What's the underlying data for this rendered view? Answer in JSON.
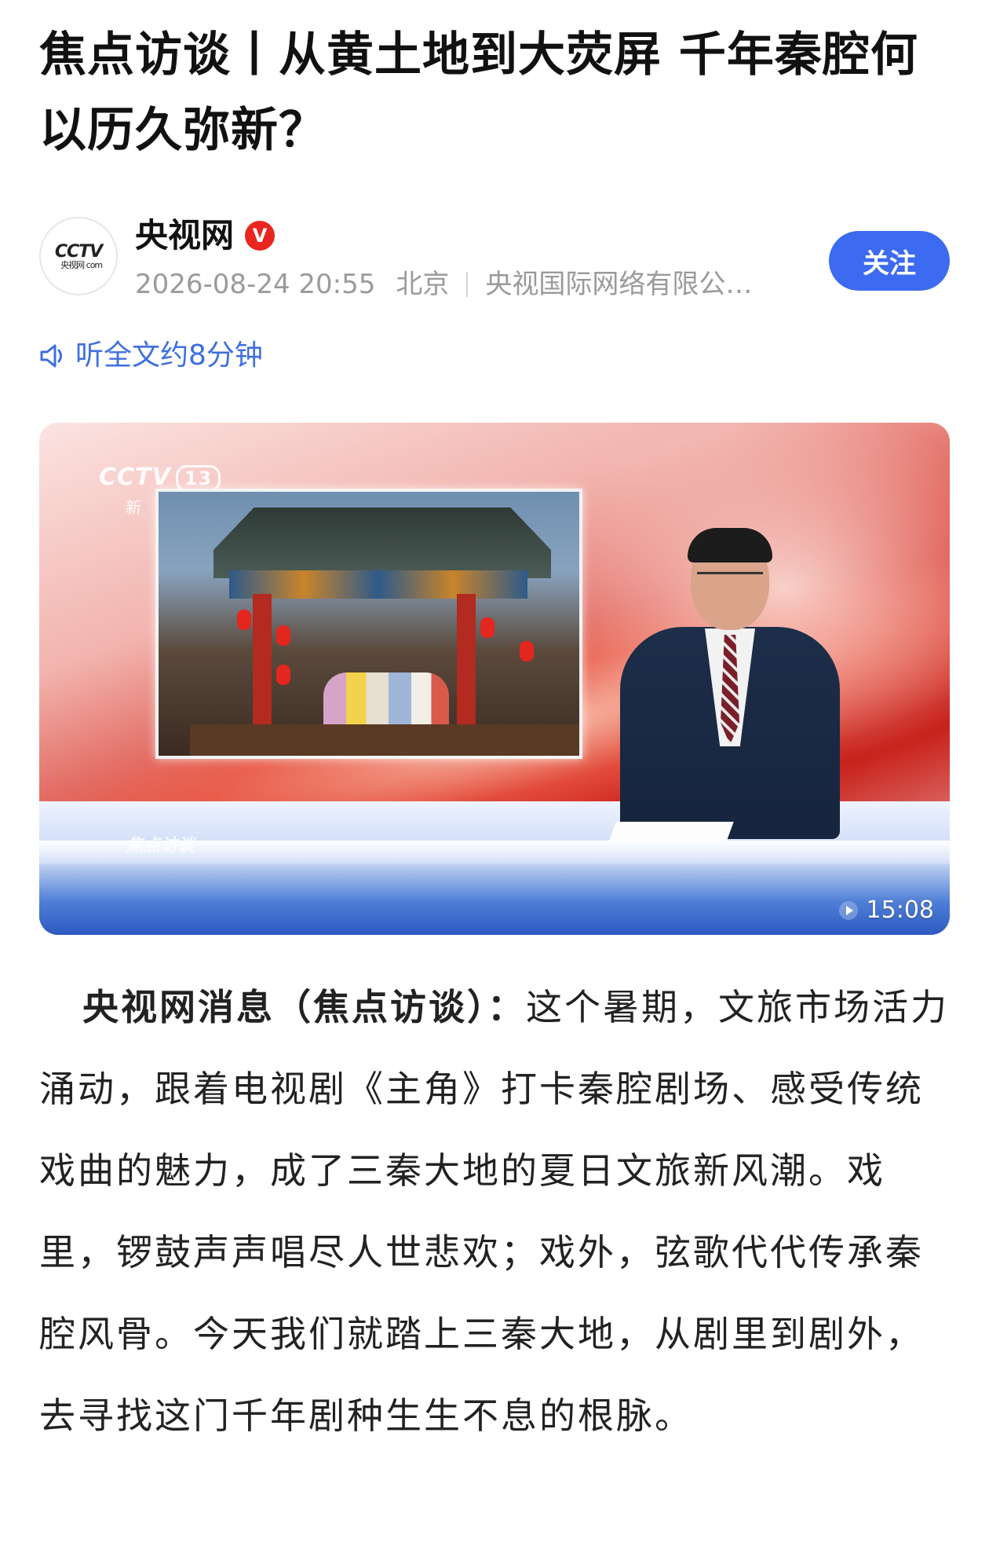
{
  "article": {
    "title": "焦点访谈丨从黄土地到大荧屏 千年秦腔何以历久弥新？",
    "author": {
      "name": "央视网",
      "avatar_text": "CCTV",
      "avatar_sub": "央视网 com",
      "verified_mark": "V"
    },
    "meta": {
      "datetime": "2026-08-24 20:55",
      "location": "北京",
      "source": "央视国际网络有限公…"
    },
    "follow_label": "关注",
    "listen_label": "听全文约8分钟",
    "video": {
      "channel_logo": "CCTV",
      "channel_number": "13",
      "channel_name": "新闻",
      "program_watermark": "焦点访谈",
      "duration": "15:08"
    },
    "body_lead": "央视网消息（焦点访谈）：",
    "body_text": "这个暑期，文旅市场活力涌动，跟着电视剧《主角》打卡秦腔剧场、感受传统戏曲的魅力，成了三秦大地的夏日文旅新风潮。戏里，锣鼓声声唱尽人世悲欢；戏外，弦歌代代传承秦腔风骨。今天我们就踏上三秦大地，从剧里到剧外，去寻找这门千年剧种生生不息的根脉。"
  },
  "colors": {
    "accent": "#3c6af0",
    "link": "#3f6fe0",
    "verified": "#e8251e",
    "meta_text": "#9a9a9a"
  },
  "icons": {
    "listen": "speaker-icon",
    "play": "play-icon",
    "verified": "verified-badge-icon"
  }
}
